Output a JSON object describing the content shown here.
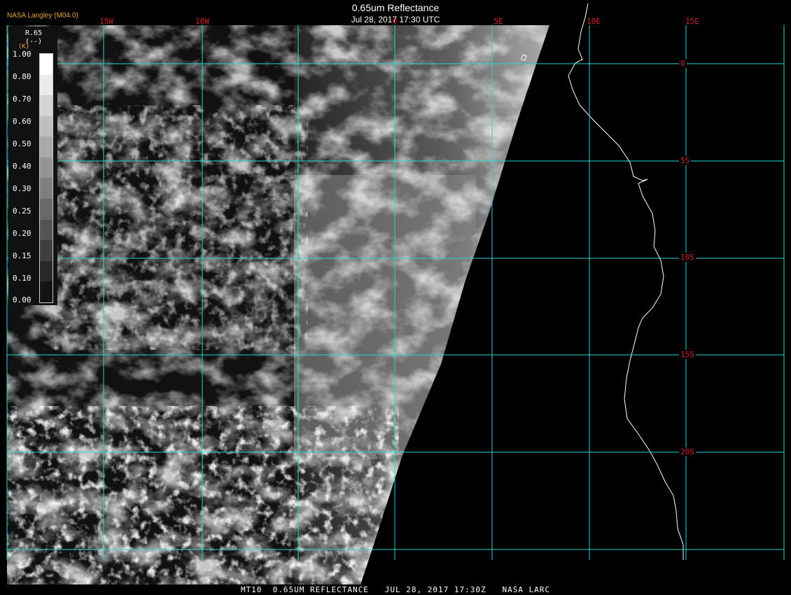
{
  "header": {
    "credit": "NASA Langley (M04.0)",
    "title": "0.65um Reflectance",
    "timestamp": "Jul 28, 2017 17:30 UTC"
  },
  "footer": {
    "caption": "MT10  0.65UM REFLECTANCE   JUL 28, 2017 17:30Z   NASA LARC"
  },
  "legend": {
    "name": "R.65",
    "units": "(--)",
    "units_prefix": "(K)",
    "ticks": [
      "1.00",
      "0.80",
      "0.70",
      "0.60",
      "0.50",
      "0.40",
      "0.30",
      "0.25",
      "0.20",
      "0.15",
      "0.10",
      "0.00"
    ]
  },
  "grid": {
    "lon_labels": [
      "15W",
      "10W",
      "0",
      "5E",
      "10E",
      "15E"
    ],
    "lat_labels": [
      "0",
      "5S",
      "10S",
      "15S",
      "20S"
    ],
    "line_color": "#2ad4d4",
    "label_color": "#d02424"
  },
  "colors": {
    "coast": "#ffffff",
    "background": "#000000"
  }
}
